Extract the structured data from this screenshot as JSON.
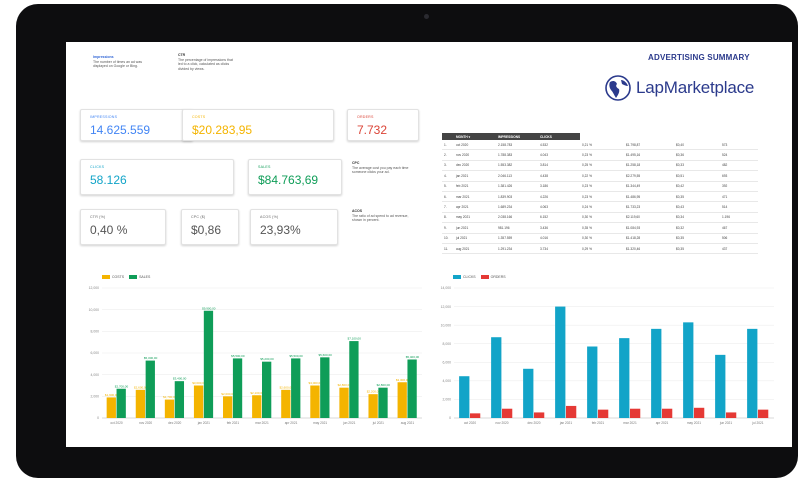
{
  "header": {
    "title": "ADVERTISING SUMMARY",
    "brand": "LapMarketplace",
    "note_left_heading": "Impressions",
    "note_left_text": "The number of times an ad was displayed on Google or Bing.",
    "note_mid_heading": "CTR",
    "note_mid_text": "The percentage of impressions that led to a click, calculated as clicks divided by views."
  },
  "kpis": {
    "impressions": {
      "label": "IMPRESSIONS",
      "value": "14.625.559"
    },
    "costs": {
      "label": "COSTS",
      "value": "$20.283,95"
    },
    "orders": {
      "label": "ORDERS",
      "value": "7.732"
    },
    "clicks": {
      "label": "CLICKS",
      "value": "58.126"
    },
    "sales": {
      "label": "SALES",
      "value": "$84.763,69"
    },
    "ctr": {
      "label": "CTR (%)",
      "value": "0,40 %"
    },
    "cpc": {
      "label": "CPC ($)",
      "value": "$0,86"
    },
    "acos": {
      "label": "ACOS (%)",
      "value": "23,93%"
    }
  },
  "notes": {
    "cpc_heading": "CPC",
    "cpc_text": "The average cost you pay each time someone clicks your ad.",
    "acos_heading": "ACOS",
    "acos_text": "The ratio of ad spend to ad revenue, shown in percent."
  },
  "table": {
    "headers": [
      "MONTH",
      "IMPRESSIONS",
      "CLICKS",
      "",
      "",
      "",
      "",
      ""
    ],
    "rows": [
      [
        "1.",
        "oct 2020",
        "2.158.783",
        "4.532",
        "0,21 %",
        "$1.798,87",
        "$0,40",
        "573"
      ],
      [
        "2.",
        "nov 2020",
        "1.788.383",
        "4.043",
        "0,23 %",
        "$1.495,16",
        "$0,36",
        "524"
      ],
      [
        "3.",
        "dec 2020",
        "1.553.382",
        "3.814",
        "0,25 %",
        "$1.258,18",
        "$0,33",
        "482"
      ],
      [
        "4.",
        "jan 2021",
        "2.046.113",
        "4.438",
        "0,22 %",
        "$2.279,55",
        "$0,51",
        "693"
      ],
      [
        "5.",
        "feb 2021",
        "1.381.426",
        "3.186",
        "0,23 %",
        "$1.344,49",
        "$0,42",
        "392"
      ],
      [
        "6.",
        "mar 2021",
        "1.839.903",
        "4.226",
        "0,23 %",
        "$1.486,95",
        "$0,35",
        "471"
      ],
      [
        "7.",
        "apr 2021",
        "1.689.234",
        "4.063",
        "0,24 %",
        "$1.733,23",
        "$0,43",
        "514"
      ],
      [
        "8.",
        "may 2021",
        "2.038.166",
        "6.152",
        "0,30 %",
        "$2.119,60",
        "$0,34",
        "1.196"
      ],
      [
        "9.",
        "jun 2021",
        "981.196",
        "3.436",
        "0,35 %",
        "$1.084,93",
        "$0,32",
        "467"
      ],
      [
        "10.",
        "jul 2021",
        "1.357.559",
        "4.016",
        "0,30 %",
        "$1.418,28",
        "$0,35",
        "506"
      ],
      [
        "11.",
        "aug 2021",
        "1.291.234",
        "3.734",
        "0,29 %",
        "$1.320,46",
        "$0,35",
        "437"
      ]
    ]
  },
  "chart_data": [
    {
      "type": "bar",
      "series": [
        {
          "name": "COSTS",
          "color": "#f4b400",
          "values": [
            1900,
            2600,
            1700,
            3000,
            2000,
            2100,
            2600,
            3000,
            2800,
            2200,
            3300
          ]
        },
        {
          "name": "SALES",
          "color": "#0f9d58",
          "values": [
            2700,
            5300,
            3400,
            9900,
            5500,
            5200,
            5500,
            5600,
            7100,
            2800,
            5400
          ]
        }
      ],
      "categories": [
        "oct 2020",
        "nov 2020",
        "dec 2020",
        "jan 2021",
        "feb 2021",
        "mar 2021",
        "apr 2021",
        "may 2021",
        "jun 2021",
        "jul 2021",
        "aug 2021"
      ],
      "ylim": [
        0,
        12000
      ],
      "ticks": [
        0,
        2000,
        4000,
        6000,
        8000,
        10000,
        12000
      ]
    },
    {
      "type": "bar",
      "series": [
        {
          "name": "CLICKS",
          "color": "#12a4c8",
          "values": [
            4500,
            8700,
            5300,
            12000,
            7700,
            8600,
            9600,
            10300,
            6800,
            9600
          ]
        },
        {
          "name": "ORDERS",
          "color": "#e53935",
          "values": [
            500,
            1000,
            600,
            1300,
            900,
            1000,
            1000,
            1100,
            600,
            900
          ]
        }
      ],
      "categories": [
        "oct 2020",
        "nov 2020",
        "dec 2020",
        "jan 2021",
        "feb 2021",
        "mar 2021",
        "apr 2021",
        "may 2021",
        "jun 2021",
        "jul 2021"
      ],
      "ylim": [
        0,
        14000
      ],
      "ticks": [
        0,
        2000,
        4000,
        6000,
        8000,
        10000,
        12000,
        14000
      ]
    }
  ]
}
